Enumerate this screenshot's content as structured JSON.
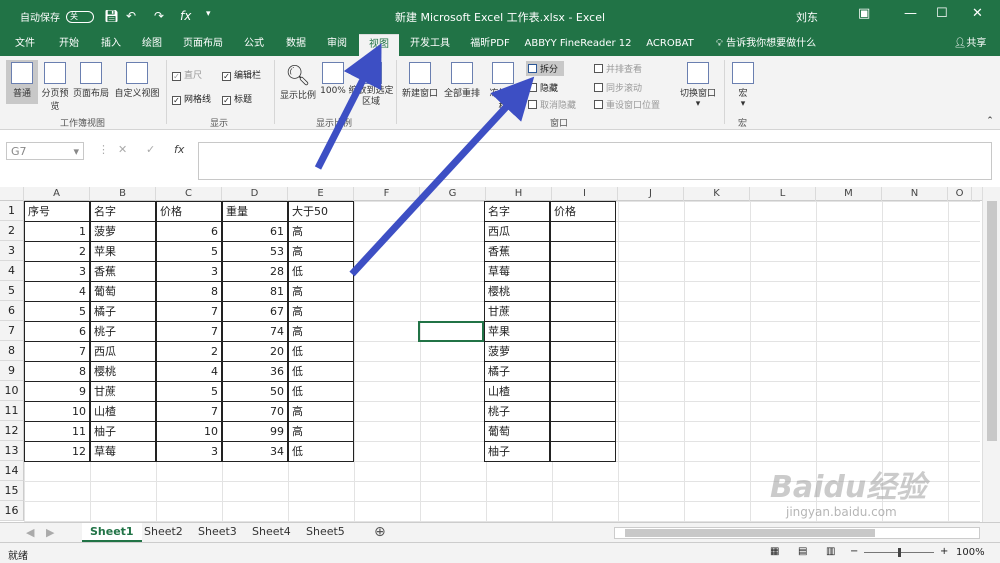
{
  "qa": {
    "autosave": "自动保存",
    "autosave_state": "关"
  },
  "window": {
    "title": "新建 Microsoft Excel 工作表.xlsx  -  Excel",
    "user": "刘东",
    "share": "共享"
  },
  "tabs": [
    "文件",
    "开始",
    "插入",
    "绘图",
    "页面布局",
    "公式",
    "数据",
    "审阅",
    "视图",
    "开发工具",
    "福昕PDF",
    "ABBYY FineReader 12",
    "ACROBAT"
  ],
  "tell_me": "告诉我你想要做什么",
  "ribbon": {
    "workbook_views": {
      "group": "工作簿视图",
      "items": [
        "普通",
        "分页预览",
        "页面布局",
        "自定义视图"
      ]
    },
    "show": {
      "group": "显示",
      "items": [
        "直尺",
        "编辑栏",
        "网格线",
        "标题"
      ]
    },
    "zoom": {
      "group": "显示比例",
      "items": [
        "显示比例",
        "100%",
        "缩放到选定区域"
      ]
    },
    "window": {
      "group": "窗口",
      "items": [
        "新建窗口",
        "全部重排",
        "冻结窗格",
        "拆分",
        "隐藏",
        "取消隐藏",
        "并排查看",
        "同步滚动",
        "重设窗口位置",
        "切换窗口"
      ]
    },
    "macro": {
      "group": "宏",
      "items": [
        "宏"
      ]
    }
  },
  "formula_bar": {
    "name_box": "G7",
    "fx": "fx"
  },
  "columns": [
    "A",
    "B",
    "C",
    "D",
    "E",
    "F",
    "G",
    "H",
    "I",
    "J",
    "K",
    "L",
    "M",
    "N",
    "O"
  ],
  "rows": [
    "1",
    "2",
    "3",
    "4",
    "5",
    "6",
    "7",
    "8",
    "9",
    "10",
    "11",
    "12",
    "13",
    "14",
    "15",
    "16"
  ],
  "table1": {
    "headers": [
      "序号",
      "名字",
      "价格",
      "重量",
      "大于50"
    ],
    "rows": [
      [
        "1",
        "菠萝",
        "6",
        "61",
        "高"
      ],
      [
        "2",
        "苹果",
        "5",
        "53",
        "高"
      ],
      [
        "3",
        "香蕉",
        "3",
        "28",
        "低"
      ],
      [
        "4",
        "葡萄",
        "8",
        "81",
        "高"
      ],
      [
        "5",
        "橘子",
        "7",
        "67",
        "高"
      ],
      [
        "6",
        "桃子",
        "7",
        "74",
        "高"
      ],
      [
        "7",
        "西瓜",
        "2",
        "20",
        "低"
      ],
      [
        "8",
        "樱桃",
        "4",
        "36",
        "低"
      ],
      [
        "9",
        "甘蔗",
        "5",
        "50",
        "低"
      ],
      [
        "10",
        "山楂",
        "7",
        "70",
        "高"
      ],
      [
        "11",
        "柚子",
        "10",
        "99",
        "高"
      ],
      [
        "12",
        "草莓",
        "3",
        "34",
        "低"
      ]
    ]
  },
  "table2": {
    "headers": [
      "名字",
      "价格"
    ],
    "names": [
      "西瓜",
      "香蕉",
      "草莓",
      "樱桃",
      "甘蔗",
      "苹果",
      "菠萝",
      "橘子",
      "山楂",
      "桃子",
      "葡萄",
      "柚子"
    ]
  },
  "sheets": [
    "Sheet1",
    "Sheet2",
    "Sheet3",
    "Sheet4",
    "Sheet5"
  ],
  "status": {
    "ready": "就绪",
    "zoom": "100%"
  },
  "watermark": {
    "brand": "Baidu经验",
    "url": "jingyan.baidu.com"
  },
  "accent": "#217346",
  "arrow_color": "#3d4fc4"
}
